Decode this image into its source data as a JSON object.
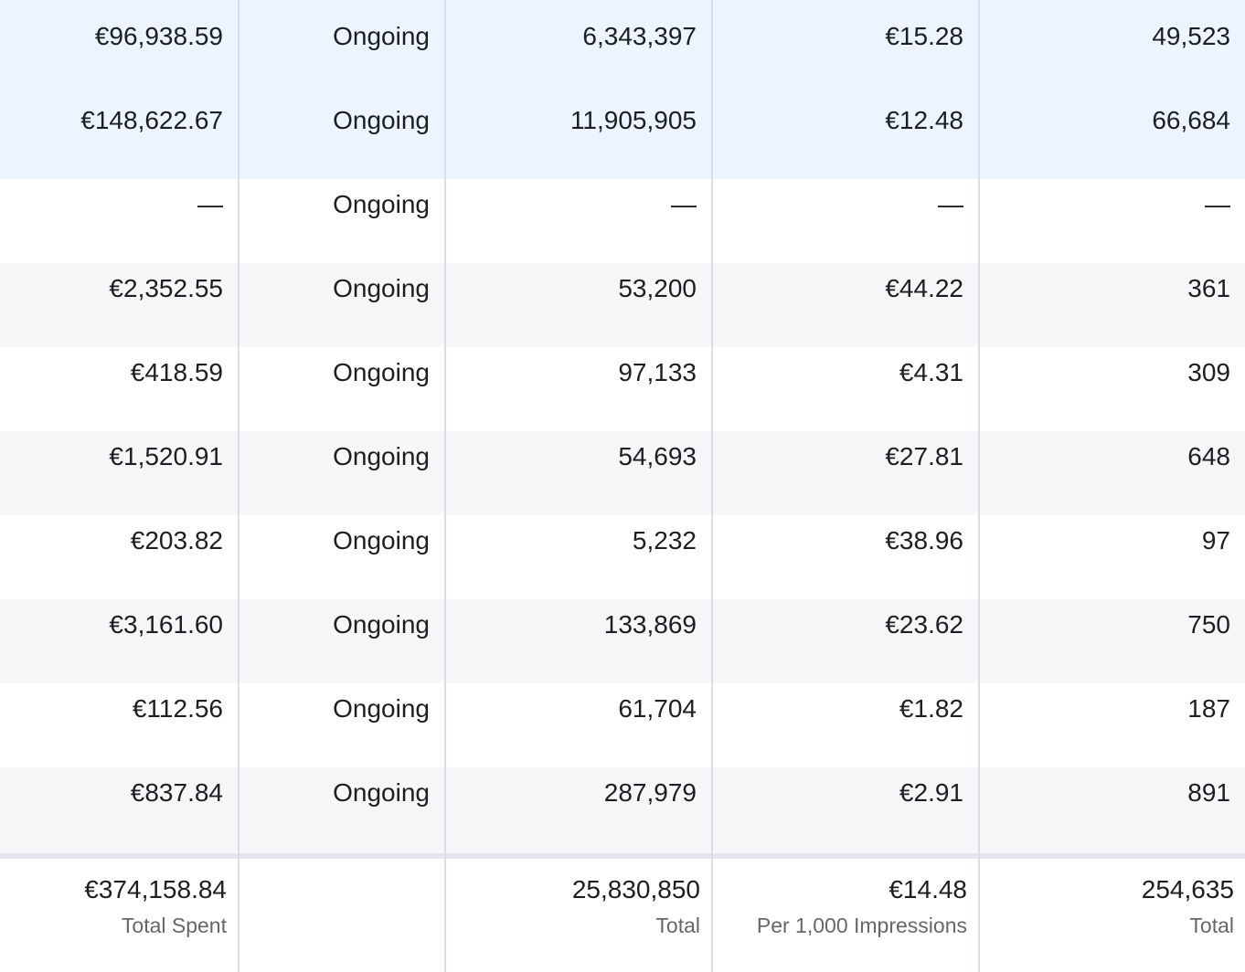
{
  "rows": [
    {
      "amount_spent": "€96,938.59",
      "ends": "Ongoing",
      "impressions": "6,343,397",
      "cpm": "€15.28",
      "link_clicks": "49,523"
    },
    {
      "amount_spent": "€148,622.67",
      "ends": "Ongoing",
      "impressions": "11,905,905",
      "cpm": "€12.48",
      "link_clicks": "66,684"
    },
    {
      "amount_spent": "—",
      "ends": "Ongoing",
      "impressions": "—",
      "cpm": "—",
      "link_clicks": "—"
    },
    {
      "amount_spent": "€2,352.55",
      "ends": "Ongoing",
      "impressions": "53,200",
      "cpm": "€44.22",
      "link_clicks": "361"
    },
    {
      "amount_spent": "€418.59",
      "ends": "Ongoing",
      "impressions": "97,133",
      "cpm": "€4.31",
      "link_clicks": "309"
    },
    {
      "amount_spent": "€1,520.91",
      "ends": "Ongoing",
      "impressions": "54,693",
      "cpm": "€27.81",
      "link_clicks": "648"
    },
    {
      "amount_spent": "€203.82",
      "ends": "Ongoing",
      "impressions": "5,232",
      "cpm": "€38.96",
      "link_clicks": "97"
    },
    {
      "amount_spent": "€3,161.60",
      "ends": "Ongoing",
      "impressions": "133,869",
      "cpm": "€23.62",
      "link_clicks": "750"
    },
    {
      "amount_spent": "€112.56",
      "ends": "Ongoing",
      "impressions": "61,704",
      "cpm": "€1.82",
      "link_clicks": "187"
    },
    {
      "amount_spent": "€837.84",
      "ends": "Ongoing",
      "impressions": "287,979",
      "cpm": "€2.91",
      "link_clicks": "891"
    }
  ],
  "summary": {
    "amount_spent": {
      "value": "€374,158.84",
      "label": "Total Spent"
    },
    "impressions": {
      "value": "25,830,850",
      "label": "Total"
    },
    "cpm": {
      "value": "€14.48",
      "label": "Per 1,000 Impressions"
    },
    "link_clicks": {
      "value": "254,635",
      "label": "Total"
    }
  },
  "colors": {
    "selected_row": "#ebf4ff",
    "shaded_row": "#f5f6f7",
    "grid_line": "#dadde1",
    "text": "#1c1e21",
    "secondary_text": "#65676b"
  }
}
